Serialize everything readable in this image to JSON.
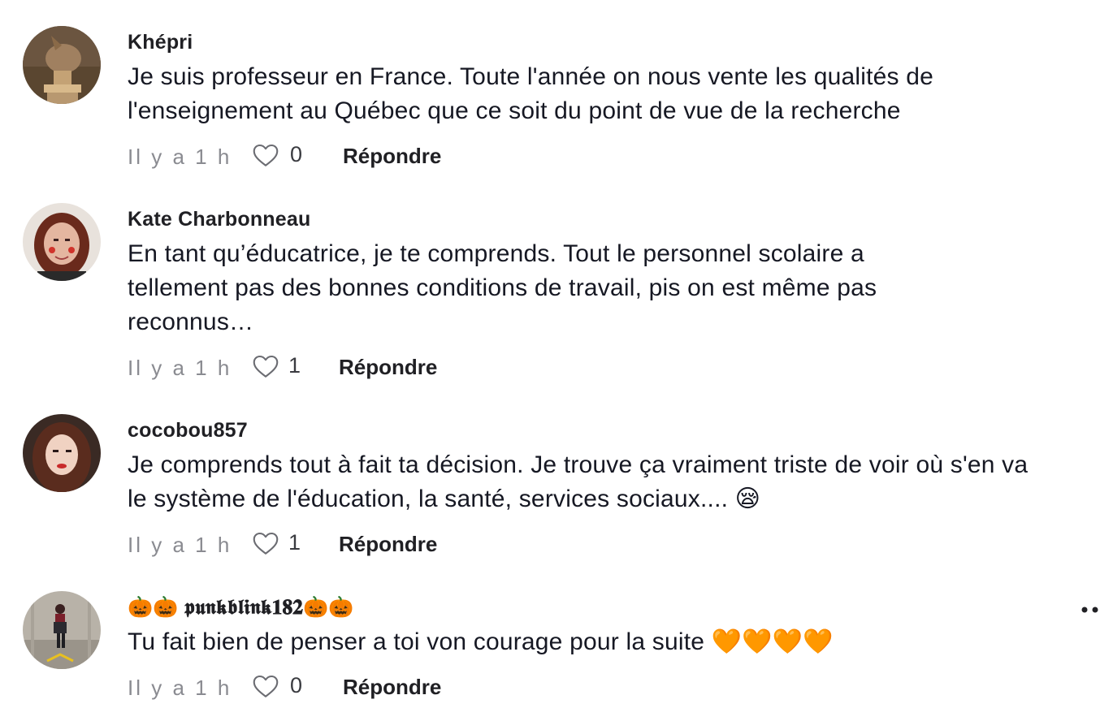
{
  "comments": [
    {
      "username": "Khépri",
      "text": "Je suis professeur en France. Toute l'année on nous vente les qualités de l'enseignement au Québec que ce soit du point de vue de la recherche",
      "time": "Il y a 1 h",
      "likes": "0",
      "reply_label": "Répondre"
    },
    {
      "username": "Kate Charbonneau",
      "text": "En tant qu’éducatrice, je te comprends. Tout le personnel scolaire a tellement pas des bonnes conditions de travail, pis on est même pas reconnus…",
      "time": "Il y a 1 h",
      "likes": "1",
      "reply_label": "Répondre"
    },
    {
      "username": "cocobou857",
      "text": "Je comprends tout à fait ta décision. Je trouve ça vraiment triste de voir où s'en va le système de l'éducation, la santé, services sociaux.... 😪",
      "time": "Il y a 1 h",
      "likes": "1",
      "reply_label": "Répondre"
    },
    {
      "username": "🎃🎃 𝖕𝖚𝖓𝖐𝖇𝖑𝖎𝖓𝖐𝟏𝟖𝟐🎃🎃",
      "text": "Tu fait bien de penser a toi von courage pour la suite 🧡🧡🧡🧡",
      "time": "Il y a 1 h",
      "likes": "0",
      "reply_label": "Répondre"
    }
  ],
  "icons": {
    "like": "heart-outline-icon",
    "more": "more-horizontal-icon"
  },
  "colors": {
    "text": "#161823",
    "muted": "#8a8b91"
  }
}
